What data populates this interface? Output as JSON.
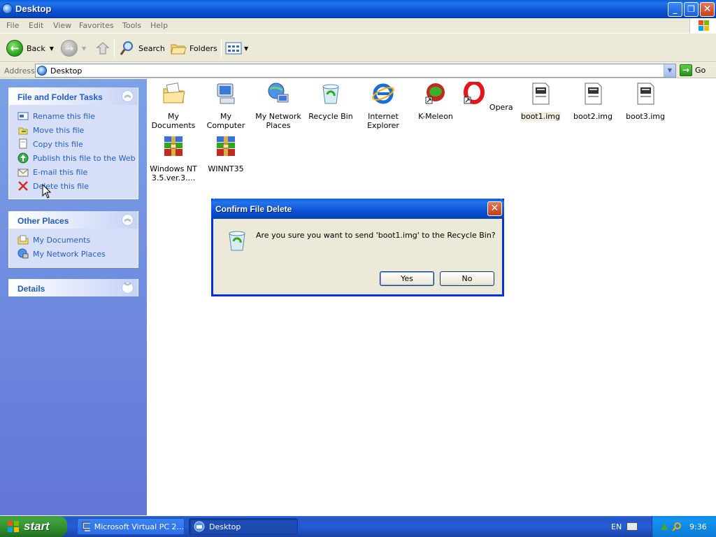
{
  "window": {
    "title": "Desktop",
    "minimize_icon": "minimize-icon",
    "maximize_icon": "restore-icon",
    "close_icon": "close-icon"
  },
  "menu": [
    "File",
    "Edit",
    "View",
    "Favorites",
    "Tools",
    "Help"
  ],
  "toolbar": {
    "back_label": "Back",
    "search_label": "Search",
    "folders_label": "Folders"
  },
  "address": {
    "label": "Address",
    "value": "Desktop",
    "go_label": "Go"
  },
  "panels": {
    "file_tasks": {
      "title": "File and Folder Tasks",
      "items": [
        {
          "label": "Rename this file",
          "icon": "rename-icon"
        },
        {
          "label": "Move this file",
          "icon": "move-icon"
        },
        {
          "label": "Copy this file",
          "icon": "copy-icon"
        },
        {
          "label": "Publish this file to the Web",
          "icon": "publish-icon"
        },
        {
          "label": "E-mail this file",
          "icon": "email-icon"
        },
        {
          "label": "Delete this file",
          "icon": "delete-icon"
        }
      ]
    },
    "other_places": {
      "title": "Other Places",
      "items": [
        {
          "label": "My Documents",
          "icon": "my-documents-icon"
        },
        {
          "label": "My Network Places",
          "icon": "network-places-icon"
        }
      ]
    },
    "details": {
      "title": "Details"
    }
  },
  "desktop_items": [
    {
      "label": "My Documents",
      "icon": "my-documents-icon"
    },
    {
      "label": "My Computer",
      "icon": "my-computer-icon"
    },
    {
      "label": "My Network Places",
      "icon": "network-places-icon"
    },
    {
      "label": "Recycle Bin",
      "icon": "recycle-bin-icon"
    },
    {
      "label": "Internet Explorer",
      "icon": "internet-explorer-icon"
    },
    {
      "label": "K-Meleon",
      "icon": "k-meleon-icon"
    },
    {
      "label": "Opera",
      "icon": "opera-icon"
    },
    {
      "label": "boot1.img",
      "icon": "image-file-icon",
      "selected": true
    },
    {
      "label": "boot2.img",
      "icon": "image-file-icon"
    },
    {
      "label": "boot3.img",
      "icon": "image-file-icon"
    },
    {
      "label": "Windows NT 3.5.ver.3....",
      "icon": "winrar-archive-icon"
    },
    {
      "label": "WINNT35",
      "icon": "winrar-archive-icon"
    }
  ],
  "dialog": {
    "title": "Confirm File Delete",
    "message": "Are you sure you want to send 'boot1.img' to the Recycle Bin?",
    "yes_label": "Yes",
    "no_label": "No"
  },
  "taskbar": {
    "start_label": "start",
    "tasks": [
      {
        "label": "Microsoft Virtual PC 2...",
        "icon": "virtual-pc-icon"
      },
      {
        "label": "Desktop",
        "icon": "desktop-icon"
      }
    ],
    "language": "EN",
    "clock": "9:36"
  },
  "colors": {
    "title_blue": "#0a52d6",
    "panel_link": "#215dc6",
    "left_pane": "#6f8edf",
    "start_green": "#3ea43e"
  }
}
